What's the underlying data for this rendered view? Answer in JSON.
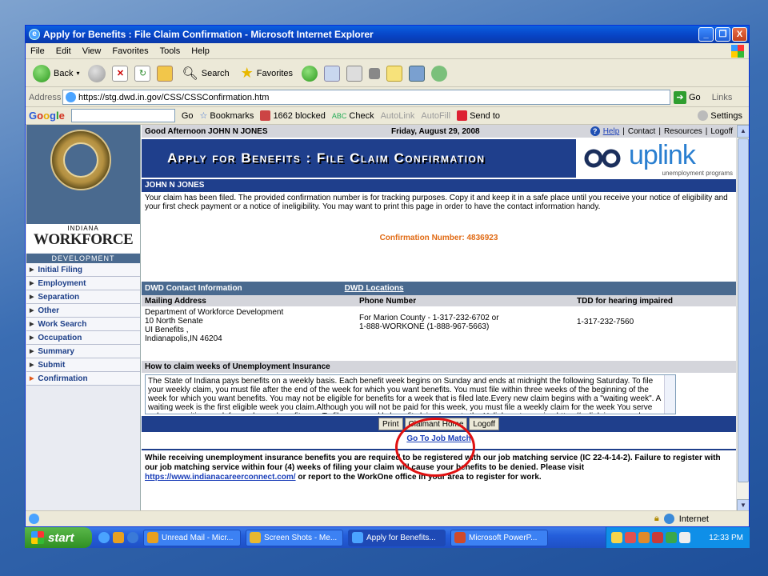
{
  "window": {
    "title": "Apply for Benefits : File Claim Confirmation - Microsoft Internet Explorer",
    "controls": [
      "_",
      "❐",
      "X"
    ]
  },
  "menu": [
    "File",
    "Edit",
    "View",
    "Favorites",
    "Tools",
    "Help"
  ],
  "toolbar": {
    "back": "Back",
    "search": "Search",
    "favorites": "Favorites"
  },
  "address": {
    "label": "Address",
    "url": "https://stg.dwd.in.gov/CSS/CSSConfirmation.htm",
    "go": "Go",
    "links": "Links"
  },
  "google_bar": {
    "logo": "Google",
    "go": "Go",
    "bookmarks": "Bookmarks",
    "blocked": "1662 blocked",
    "check": "Check",
    "autolink": "AutoLink",
    "autofill": "AutoFill",
    "send_to": "Send to",
    "settings": "Settings"
  },
  "page": {
    "greeting": "Good Afternoon JOHN N JONES",
    "date": "Friday, August 29, 2008",
    "top_links": {
      "help": "Help",
      "contact": "Contact",
      "resources": "Resources",
      "logoff": "Logoff",
      "sep": "|"
    },
    "banner_title": "Apply for Benefits : File Claim Confirmation",
    "uplink": {
      "word": "uplink",
      "sub": "unemployment programs"
    },
    "claimant_name": "JOHN N JONES",
    "notice": "Your claim has been filed. The provided confirmation number is for tracking purposes. Copy it and keep it in a safe place until you receive your notice of eligibility and your first check payment or a notice of ineligibility. You may want to print this page in order to have the contact information handy.",
    "confirmation_label": "Confirmation Number:",
    "confirmation_number": "4836923",
    "contact": {
      "header": "DWD Contact Information",
      "locations_link": "DWD Locations",
      "col_mailing": "Mailing Address",
      "col_phone": "Phone Number",
      "col_tdd": "TDD for hearing impaired",
      "address_lines": [
        "Department of Workforce Development",
        "10 North Senate",
        "UI Benefits ,",
        "Indianapolis,IN 46204"
      ],
      "phone_lines": [
        "For Marion County - 1-317-232-6702 or",
        "1-888-WORKONE (1-888-967-5663)"
      ],
      "tdd": "1-317-232-7560"
    },
    "howto": {
      "header": "How to claim weeks of Unemployment Insurance",
      "text": "The State of Indiana pays benefits on a weekly basis. Each benefit week begins on Sunday and ends at midnight the following Saturday. To file your weekly claim, you must file after the end of the week for which you want benefits. You must file within three weeks of the beginning of the week for which you want benefits. You may not be eligible for benefits for a week that is filed late.Every new claim begins with a \"waiting week\". A waiting week is the first eligible week you claim.Although you will not be paid for this week, you must file a weekly claim for the week You serve only one waiting week for each new benefit year. To file your weekly benefit claim, logon to the Uplink system using https://uplink.in.gov and choose FILE MY WEEKLY CLAIM"
    },
    "buttons": {
      "print": "Print",
      "claimant_home": "Claimant Home",
      "logoff": "Logoff"
    },
    "job_match_link": "Go To Job Match",
    "warning_text": "While receiving unemployment insurance benefits you are required to be registered with our job matching service (IC 22-4-14-2). Failure to register with our job matching service within four (4) weeks of filing your claim will cause your benefits to be denied. Please visit",
    "warning_link": "https://www.indianacareerconnect.com/",
    "warning_tail": "or report to the WorkOne office in your area to register for work."
  },
  "logo": {
    "indiana": "INDIANA",
    "workforce": "WORKFORCE",
    "development": "DEVELOPMENT"
  },
  "nav": [
    "Initial Filing",
    "Employment",
    "Separation",
    "Other",
    "Work Search",
    "Occupation",
    "Summary",
    "Submit",
    "Confirmation"
  ],
  "nav_active": "Confirmation",
  "status": {
    "zone": "Internet"
  },
  "taskbar": {
    "start": "start",
    "tasks": [
      "Unread Mail - Micr...",
      "Screen Shots - Me...",
      "Apply for Benefits...",
      "Microsoft PowerP..."
    ],
    "active_task": "Apply for Benefits...",
    "clock": "12:33 PM"
  },
  "colors": {
    "banner": "#1f3f8c",
    "accent_orange": "#e06a14",
    "highlight_circle": "#e01010",
    "xp_blue": "#0842c3"
  }
}
